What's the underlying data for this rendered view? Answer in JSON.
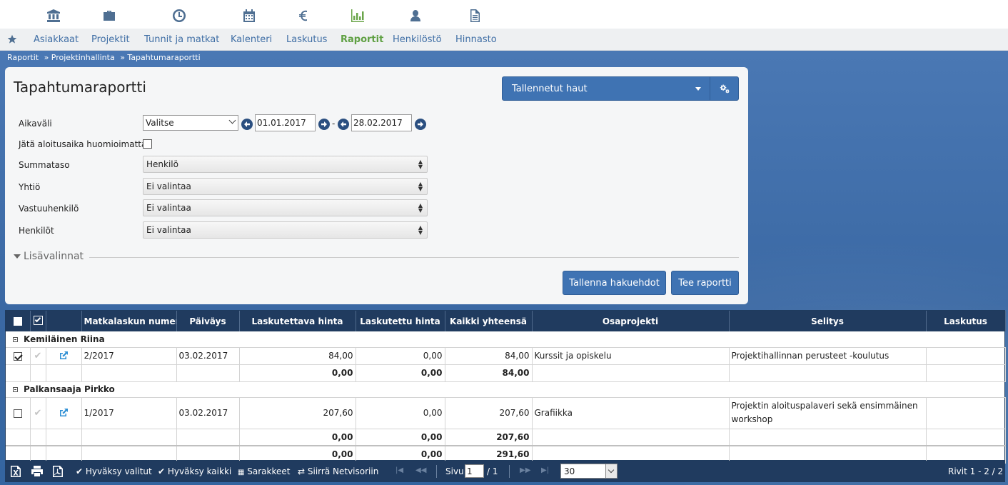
{
  "nav": {
    "items": [
      "Asiakkaat",
      "Projektit",
      "Tunnit ja matkat",
      "Kalenteri",
      "Laskutus",
      "Raportit",
      "Henkilöstö",
      "Hinnasto"
    ],
    "active": "Raportit"
  },
  "icons": [
    "bank-icon",
    "briefcase-icon",
    "clock-icon",
    "calendar-icon",
    "euro-icon",
    "bar-chart-icon",
    "person-icon",
    "document-icon"
  ],
  "breadcrumb": [
    "Raportit",
    "» Projektinhallinta",
    "» Tapahtumaraportti"
  ],
  "form": {
    "title": "Tapahtumaraportti",
    "saved_searches": "Tallennetut haut",
    "period_label": "Aikaväli",
    "period_select": "Valitse",
    "date_from": "01.01.2017",
    "date_sep": "-",
    "date_to": "28.02.2017",
    "ignore_start_label": "Jätä aloitusaika huomioimatta",
    "sum_level_label": "Summataso",
    "sum_level_value": "Henkilö",
    "company_label": "Yhtiö",
    "company_value": "Ei valintaa",
    "responsible_label": "Vastuuhenkilö",
    "responsible_value": "Ei valintaa",
    "persons_label": "Henkilöt",
    "persons_value": "Ei valintaa",
    "more_options": "Lisävalinnat",
    "save_criteria": "Tallenna hakuehdot",
    "make_report": "Tee raportti"
  },
  "table": {
    "headers": [
      "Matkalaskun numero",
      "Päiväys",
      "Laskutettava hinta",
      "Laskutettu hinta",
      "Kaikki yhteensä",
      "Osaprojekti",
      "Selitys",
      "Laskutus"
    ],
    "groups": [
      {
        "name": "Kemiläinen Riina",
        "rows": [
          {
            "checked": true,
            "number": "2/2017",
            "date": "03.02.2017",
            "billable": "84,00",
            "billed": "0,00",
            "total": "84,00",
            "subproject": "Kurssit ja opiskelu",
            "description": "Projektihallinnan perusteet -koulutus",
            "billing": ""
          }
        ],
        "subtotal": {
          "billable": "0,00",
          "billed": "0,00",
          "total": "84,00"
        }
      },
      {
        "name": "Palkansaaja Pirkko",
        "rows": [
          {
            "checked": false,
            "number": "1/2017",
            "date": "03.02.2017",
            "billable": "207,60",
            "billed": "0,00",
            "total": "207,60",
            "subproject": "Grafiikka",
            "description_line1": "Projektin aloituspalaveri sekä ensimmäinen",
            "description_line2": "workshop",
            "billing": ""
          }
        ],
        "subtotal": {
          "billable": "0,00",
          "billed": "0,00",
          "total": "207,60"
        }
      }
    ],
    "grand_total": {
      "billable": "0,00",
      "billed": "0,00",
      "total": "291,60"
    }
  },
  "toolbar": {
    "approve_selected": "Hyväksy valitut",
    "approve_all": "Hyväksy kaikki",
    "columns": "Sarakkeet",
    "move_netvisor": "Siirrä Netvisoriin",
    "page_label": "Sivu",
    "page_value": "1",
    "page_total": "/ 1",
    "per_page": "30",
    "rows_info": "Rivit 1 - 2 / 2"
  },
  "colors": {
    "accent": "#3f73b3",
    "active_nav": "#5fa043",
    "grid_header": "#203b5f"
  }
}
